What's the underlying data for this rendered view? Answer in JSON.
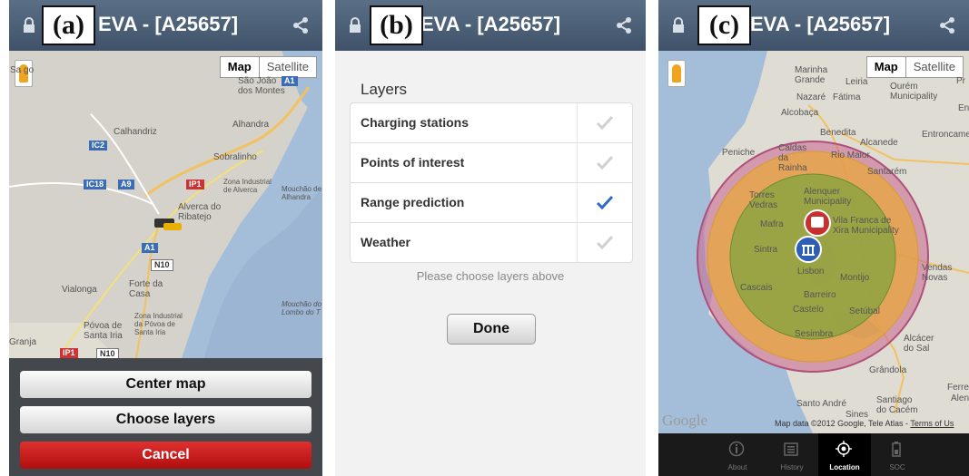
{
  "app": {
    "title": "EVA - [A25657]"
  },
  "panels": {
    "a": "(a)",
    "b": "(b)",
    "c": "(c)"
  },
  "map": {
    "type_map": "Map",
    "type_satellite": "Satellite"
  },
  "map_a_labels": {
    "sao_joao": "São João dos Montes",
    "calhandriz": "Calhandriz",
    "alhandra": "Alhandra",
    "sobralinho": "Sobralinho",
    "zona_alverca": "Zona Industrial de Alverca",
    "mouchao_alhandra": "Mouchão de Alhandra",
    "alverca": "Alverca do Ribatejo",
    "vialonga": "Vialonga",
    "forte": "Forte da Casa",
    "mouchao_lombo": "Mouchão do Lombo do T",
    "povoa": "Póvoa de Santa Iria",
    "zona_povoa": "Zona Industrial da Póvoa de Santa Iria",
    "sa_go": "Sa go",
    "granja": "Granja"
  },
  "map_a_shields": {
    "a1": "A1",
    "ic2": "IC2",
    "ic18": "IC18",
    "a9": "A9",
    "ip1": "IP1",
    "n10": "N10"
  },
  "dialog_a": {
    "center": "Center map",
    "choose": "Choose layers",
    "cancel": "Cancel"
  },
  "layers": {
    "heading": "Layers",
    "items": [
      {
        "label": "Charging stations",
        "checked": false
      },
      {
        "label": "Points of interest",
        "checked": false
      },
      {
        "label": "Range prediction",
        "checked": true
      },
      {
        "label": "Weather",
        "checked": false
      }
    ],
    "hint": "Please choose layers above",
    "done": "Done"
  },
  "map_c_labels": {
    "marinha": "Marinha Grande",
    "leiria": "Leiria",
    "ourem": "Ourém Municipality",
    "nazare": "Nazaré",
    "fatima": "Fátima",
    "alcobaca": "Alcobaça",
    "benedita": "Benedita",
    "alcanede": "Alcanede",
    "entroncamento": "Entroncamen",
    "peniche": "Peniche",
    "caldas": "Caldas da Rainha",
    "rio_maior": "Rio Maior",
    "santarem": "Santarém",
    "torres": "Torres Vedras",
    "alenquer": "Alenquer Municipality",
    "mafra": "Mafra",
    "vila_franca": "Vila Franca de Xira Municipality",
    "sintra": "Sintra",
    "lisbon": "Lisbon",
    "cascais": "Cascais",
    "barreiro": "Barreiro",
    "montijo": "Montijo",
    "setubal": "Setúbal",
    "castelo": "Castelo",
    "sesimbra": "Sesimbra",
    "vendas": "Vendas Novas",
    "alcacer": "Alcácer do Sal",
    "grandola": "Grândola",
    "santo_andre": "Santo André",
    "santiago": "Santiago do Cacém",
    "sines": "Sines",
    "ferrei": "Ferrei",
    "alent": "Alent",
    "pr": "Pr",
    "en": "En"
  },
  "map_c_attrib": {
    "google": "Google",
    "data": "Map data ©2012 Google, Tele Atlas - ",
    "terms": "Terms of Us"
  },
  "tabs": [
    {
      "label": "About",
      "icon": "info-icon",
      "selected": false
    },
    {
      "label": "History",
      "icon": "history-icon",
      "selected": false
    },
    {
      "label": "Location",
      "icon": "location-icon",
      "selected": true
    },
    {
      "label": "SOC",
      "icon": "battery-icon",
      "selected": false
    }
  ],
  "colors": {
    "header": "#4d6279",
    "check_on": "#2d6cc0",
    "check_off": "#d0d0d0",
    "cancel": "#c81818",
    "range_outer": "#c8648c",
    "range_mid": "#e8a53c",
    "range_inner": "#7ca43c"
  }
}
